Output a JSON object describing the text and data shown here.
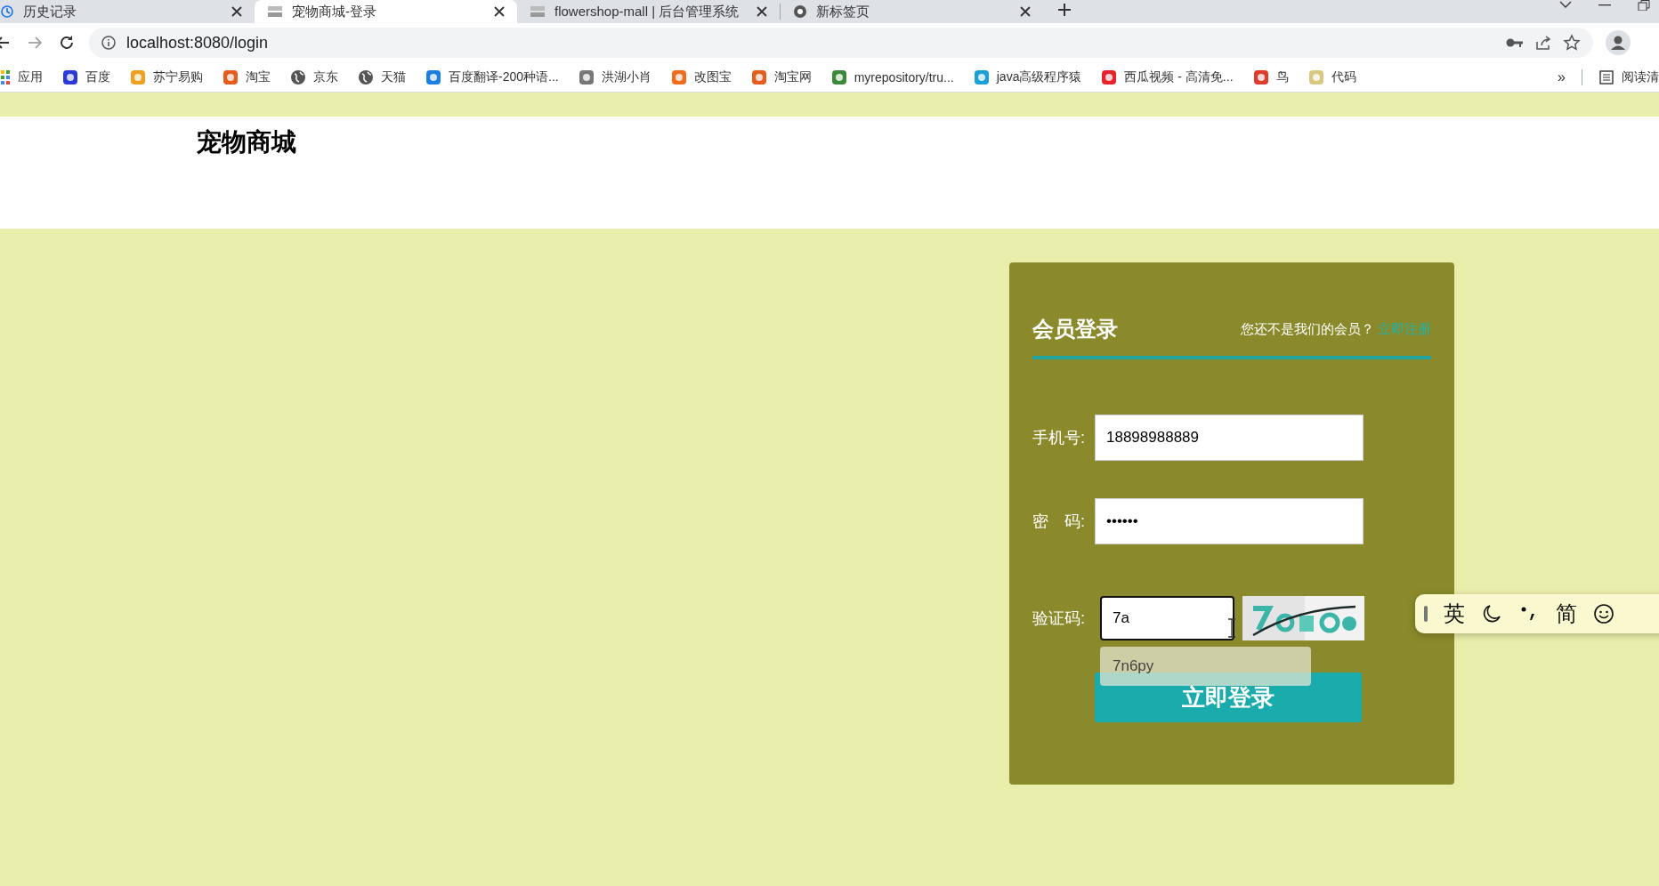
{
  "browser": {
    "tabs": [
      {
        "title": "历史记录",
        "selected": false
      },
      {
        "title": "宠物商城-登录",
        "selected": true
      },
      {
        "title": "flowershop-mall | 后台管理系统",
        "selected": false
      },
      {
        "title": "新标签页",
        "selected": false
      }
    ],
    "address": "localhost:8080/login",
    "bookmarks": [
      {
        "label": "应用"
      },
      {
        "label": "百度"
      },
      {
        "label": "苏宁易购"
      },
      {
        "label": "淘宝"
      },
      {
        "label": "京东"
      },
      {
        "label": "天猫"
      },
      {
        "label": "百度翻译-200种语..."
      },
      {
        "label": "洪湖小肖"
      },
      {
        "label": "改图宝"
      },
      {
        "label": "淘宝网"
      },
      {
        "label": "myrepository/tru..."
      },
      {
        "label": "java高级程序猿"
      },
      {
        "label": "西瓜视频 - 高清免..."
      },
      {
        "label": "鸟"
      },
      {
        "label": "代码"
      }
    ],
    "bookmarks_more": "»",
    "reading_list": "阅读清"
  },
  "page": {
    "site_title": "宠物商城",
    "login": {
      "title": "会员登录",
      "register_prompt": "您还不是我们的会员？",
      "register_link": "立即注册",
      "fields": [
        {
          "kind": "text",
          "label": "手机号:",
          "value": "18898988889",
          "focused": false
        },
        {
          "kind": "text",
          "label": "密　码:",
          "value": "••••••",
          "focused": false
        },
        {
          "kind": "captcha",
          "label": "验证码:",
          "value": "7a",
          "focused": true
        }
      ],
      "autocomplete": [
        "7n6py"
      ],
      "submit": "立即登录"
    }
  },
  "ime_toolbar": {
    "items": [
      {
        "kind": "text",
        "label": "英"
      },
      {
        "kind": "moon"
      },
      {
        "kind": "punct"
      },
      {
        "kind": "text",
        "label": "简"
      },
      {
        "kind": "smiley"
      }
    ]
  }
}
